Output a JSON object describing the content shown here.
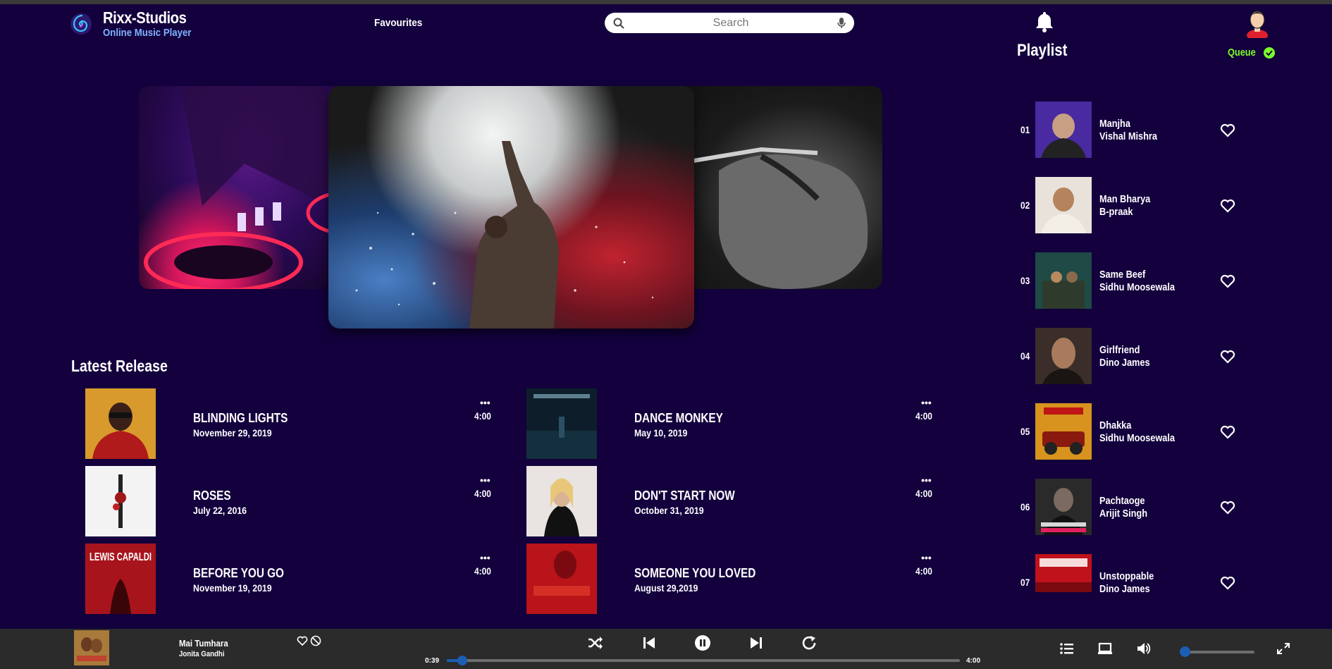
{
  "brand": {
    "name": "Rixx-Studios",
    "subtitle": "Online Music Player",
    "logo_icon": "spiral-logo-icon"
  },
  "nav": {
    "favourites": "Favourites"
  },
  "search": {
    "placeholder": "Search"
  },
  "header": {
    "playlist_title": "Playlist",
    "queue_label": "Queue"
  },
  "colors": {
    "background": "#13003d",
    "player_bar": "#2b2b2b",
    "accent_blue": "#1a5fb4",
    "queue_green": "#7dff2a",
    "brand_sub": "#7fb4ff"
  },
  "latest": {
    "title": "Latest Release",
    "items": [
      {
        "title": "BLINDING LIGHTS",
        "date": "November 29, 2019",
        "duration": "4:00"
      },
      {
        "title": "DANCE MONKEY",
        "date": "May 10, 2019",
        "duration": "4:00"
      },
      {
        "title": "ROSES",
        "date": "July 22, 2016",
        "duration": "4:00"
      },
      {
        "title": "DON'T START NOW",
        "date": "October 31, 2019",
        "duration": "4:00"
      },
      {
        "title": "BEFORE YOU GO",
        "date": "November 19, 2019",
        "duration": "4:00",
        "cover_text": "LEWIS CAPALDI"
      },
      {
        "title": "SOMEONE YOU LOVED",
        "date": "August 29,2019",
        "duration": "4:00"
      }
    ]
  },
  "playlist": {
    "items": [
      {
        "num": "01",
        "name": "Manjha",
        "artist": "Vishal Mishra"
      },
      {
        "num": "02",
        "name": "Man Bharya",
        "artist": "B-praak"
      },
      {
        "num": "03",
        "name": "Same Beef",
        "artist": "Sidhu Moosewala"
      },
      {
        "num": "04",
        "name": "Girlfriend",
        "artist": "Dino James"
      },
      {
        "num": "05",
        "name": "Dhakka",
        "artist": "Sidhu Moosewala"
      },
      {
        "num": "06",
        "name": "Pachtaoge",
        "artist": "Arijit Singh"
      },
      {
        "num": "07",
        "name": "Unstoppable",
        "artist": "Dino James"
      }
    ]
  },
  "player": {
    "title": "Mai Tumhara",
    "artist": "Jonita Gandhi",
    "current_time": "0:39",
    "total_time": "4:00",
    "progress_fraction": 0.03,
    "volume_fraction": 0.05,
    "controls": [
      "shuffle-icon",
      "previous-icon",
      "pause-icon",
      "next-icon",
      "repeat-icon"
    ],
    "right_icons": [
      "list-icon",
      "device-icon",
      "volume-icon",
      "fullscreen-icon"
    ]
  }
}
